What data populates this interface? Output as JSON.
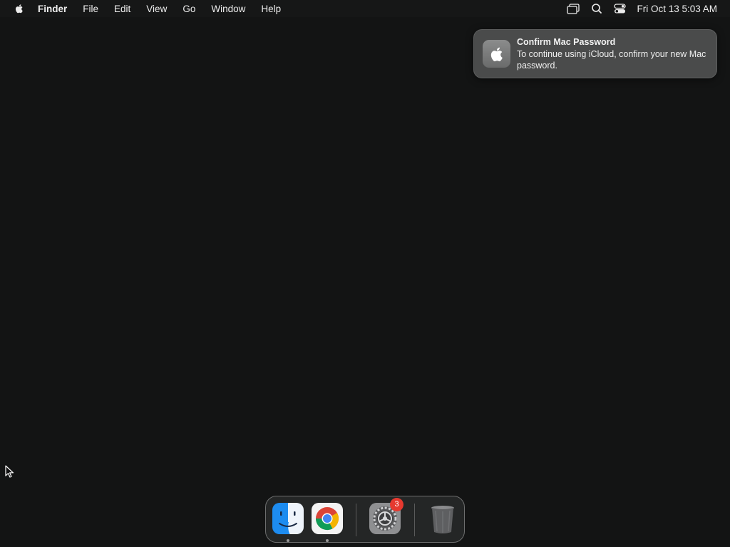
{
  "menubar": {
    "apple_icon": "apple-logo-icon",
    "items": [
      "Finder",
      "File",
      "Edit",
      "View",
      "Go",
      "Window",
      "Help"
    ],
    "status_icons": [
      "display-mirroring-icon",
      "search-icon",
      "control-center-icon"
    ],
    "clock": "Fri Oct 13  5:03 AM"
  },
  "notification": {
    "icon": "apple-logo-icon",
    "title": "Confirm Mac Password",
    "body": "To continue using iCloud, confirm your new Mac password."
  },
  "dock": {
    "apps": [
      {
        "name": "Finder",
        "icon": "finder-icon",
        "running": true
      },
      {
        "name": "Google Chrome",
        "icon": "chrome-icon",
        "running": true
      },
      {
        "name": "System Settings",
        "icon": "system-settings-icon",
        "badge": "3"
      },
      {
        "name": "Trash",
        "icon": "trash-icon"
      }
    ]
  },
  "colors": {
    "desktop": "#131414",
    "badge": "#e6392f",
    "notification_bg": "#4a4b4b"
  }
}
